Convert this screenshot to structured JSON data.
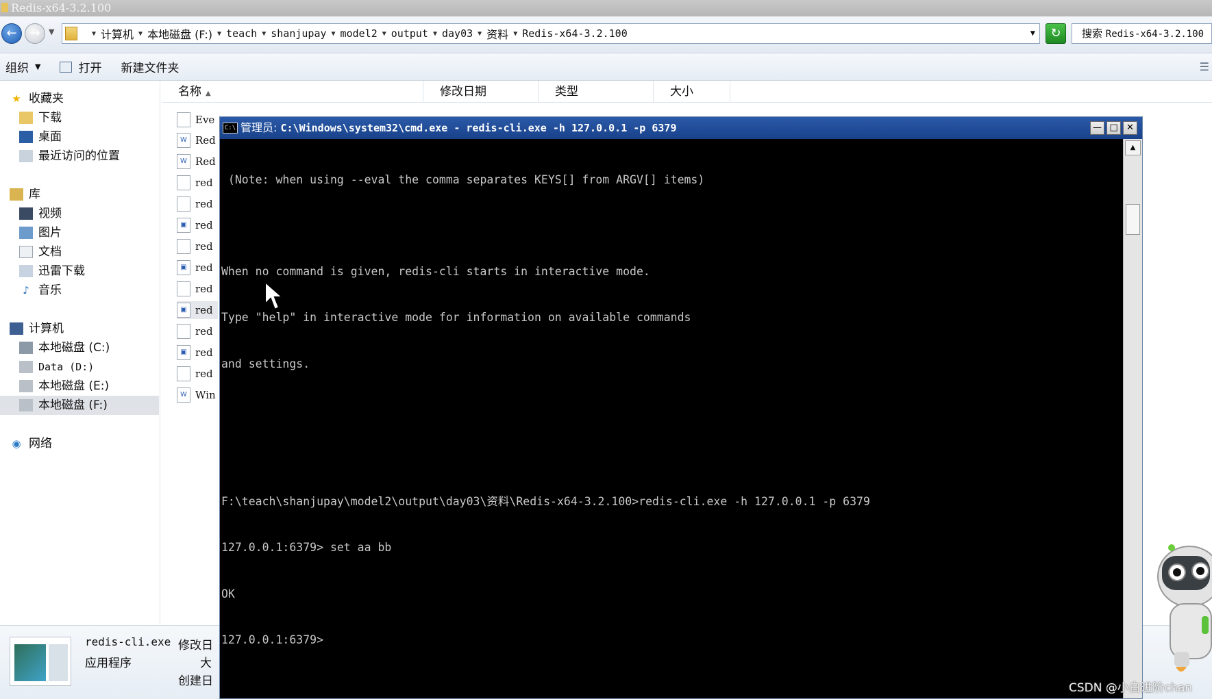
{
  "explorer": {
    "title": "Redis-x64-3.2.100",
    "breadcrumbs": [
      "计算机",
      "本地磁盘 (F:)",
      "teach",
      "shanjupay",
      "model2",
      "output",
      "day03",
      "资料",
      "Redis-x64-3.2.100"
    ],
    "search_label": "搜索",
    "search_scope": "Redis-x64-3.2.100"
  },
  "toolbar": {
    "organize_label": "组织",
    "open_label": "打开",
    "new_folder_label": "新建文件夹"
  },
  "sidebar": {
    "favorites": {
      "label": "收藏夹",
      "items": [
        "下载",
        "桌面",
        "最近访问的位置"
      ]
    },
    "libraries": {
      "label": "库",
      "items": [
        "视频",
        "图片",
        "文档",
        "迅雷下载",
        "音乐"
      ]
    },
    "computer": {
      "label": "计算机",
      "drives": [
        "本地磁盘 (C:)",
        "Data (D:)",
        "本地磁盘 (E:)",
        "本地磁盘 (F:)"
      ]
    },
    "network": {
      "label": "网络"
    }
  },
  "columns": [
    "名称",
    "修改日期",
    "类型",
    "大小"
  ],
  "files": [
    "Eve",
    "Red",
    "Red",
    "red",
    "red",
    "red",
    "red",
    "red",
    "red",
    "red",
    "red",
    "red",
    "red",
    "Win"
  ],
  "details": {
    "file_name": "redis-cli.exe",
    "file_type": "应用程序",
    "modified_label": "修改日",
    "size_label": "大",
    "created_label": "创建日"
  },
  "cmd": {
    "title_prefix": "管理员:",
    "title_path": "C:\\Windows\\system32\\cmd.exe - redis-cli.exe  -h 127.0.0.1 -p 6379",
    "lines": [
      " (Note: when using --eval the comma separates KEYS[] from ARGV[] items)",
      "",
      "When no command is given, redis-cli starts in interactive mode.",
      "Type \"help\" in interactive mode for information on available commands",
      "and settings.",
      "",
      "",
      "F:\\teach\\shanjupay\\model2\\output\\day03\\资料\\Redis-x64-3.2.100>redis-cli.exe -h 127.0.0.1 -p 6379",
      "127.0.0.1:6379> set aa bb",
      "OK",
      "127.0.0.1:6379>"
    ]
  },
  "watermark": "CSDN @小白进阶chan",
  "colors": {
    "cmd_title_bg": "#1f4c98",
    "cmd_bg": "#000000",
    "cmd_text": "#c8c8c8",
    "selection": "#dfe3e8"
  }
}
